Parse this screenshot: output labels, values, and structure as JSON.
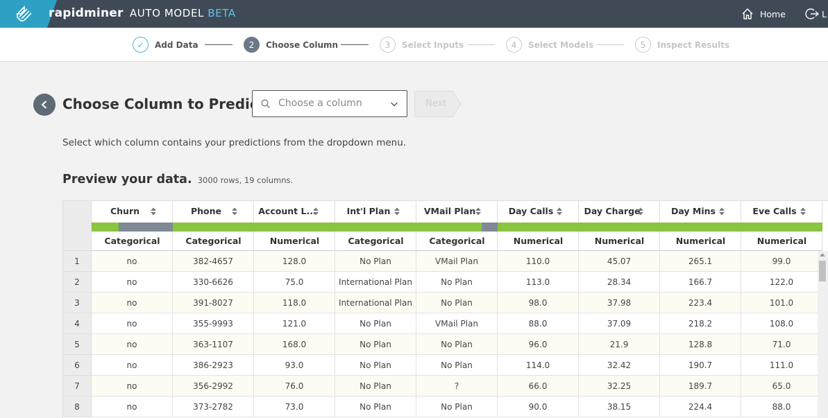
{
  "header": {
    "brand_name": "rapidminer",
    "product": "AUTO MODEL",
    "beta": "BETA",
    "home_label": "Home",
    "logout_label": "L",
    "colors": {
      "bar": "#3f4a56",
      "accent": "#2da1c4",
      "beta": "#62c3e6"
    }
  },
  "steps": [
    {
      "num": "✓",
      "label": "Add Data",
      "state": "done"
    },
    {
      "num": "2",
      "label": "Choose Column",
      "state": "active"
    },
    {
      "num": "3",
      "label": "Select Inputs",
      "state": "todo"
    },
    {
      "num": "4",
      "label": "Select Models",
      "state": "todo"
    },
    {
      "num": "5",
      "label": "Inspect Results",
      "state": "todo"
    }
  ],
  "main": {
    "title": "Choose Column to Predict:",
    "select_placeholder": "Choose a column",
    "next_label": "Next",
    "instructions": "Select which column contains your predictions from the dropdown menu.",
    "preview_heading": "Preview your data.",
    "preview_sub": "3000 rows, 19 columns."
  },
  "table": {
    "columns": [
      {
        "name": "Churn",
        "type": "Categorical",
        "quality": 0.33
      },
      {
        "name": "Phone",
        "type": "Categorical",
        "quality": 1.0
      },
      {
        "name": "Account L...",
        "type": "Numerical",
        "quality": 1.0
      },
      {
        "name": "Int'l Plan",
        "type": "Categorical",
        "quality": 1.0
      },
      {
        "name": "VMail Plan",
        "type": "Categorical",
        "quality": 0.8
      },
      {
        "name": "Day Calls",
        "type": "Numerical",
        "quality": 1.0
      },
      {
        "name": "Day Charge",
        "type": "Numerical",
        "quality": 1.0
      },
      {
        "name": "Day Mins",
        "type": "Numerical",
        "quality": 1.0
      },
      {
        "name": "Eve Calls",
        "type": "Numerical",
        "quality": 1.0
      }
    ],
    "rows": [
      {
        "n": "1",
        "cells": [
          "no",
          "382-4657",
          "128.0",
          "No Plan",
          "VMail Plan",
          "110.0",
          "45.07",
          "265.1",
          "99.0"
        ]
      },
      {
        "n": "2",
        "cells": [
          "no",
          "330-6626",
          "75.0",
          "International Plan",
          "No Plan",
          "113.0",
          "28.34",
          "166.7",
          "122.0"
        ]
      },
      {
        "n": "3",
        "cells": [
          "no",
          "391-8027",
          "118.0",
          "International Plan",
          "No Plan",
          "98.0",
          "37.98",
          "223.4",
          "101.0"
        ]
      },
      {
        "n": "4",
        "cells": [
          "no",
          "355-9993",
          "121.0",
          "No Plan",
          "VMail Plan",
          "88.0",
          "37.09",
          "218.2",
          "108.0"
        ]
      },
      {
        "n": "5",
        "cells": [
          "no",
          "363-1107",
          "168.0",
          "No Plan",
          "No Plan",
          "96.0",
          "21.9",
          "128.8",
          "71.0"
        ]
      },
      {
        "n": "6",
        "cells": [
          "no",
          "386-2923",
          "93.0",
          "No Plan",
          "No Plan",
          "114.0",
          "32.42",
          "190.7",
          "111.0"
        ]
      },
      {
        "n": "7",
        "cells": [
          "no",
          "356-2992",
          "76.0",
          "No Plan",
          "?",
          "66.0",
          "32.25",
          "189.7",
          "65.0"
        ]
      },
      {
        "n": "8",
        "cells": [
          "no",
          "373-2782",
          "73.0",
          "No Plan",
          "No Plan",
          "90.0",
          "38.15",
          "224.4",
          "88.0"
        ]
      }
    ]
  }
}
